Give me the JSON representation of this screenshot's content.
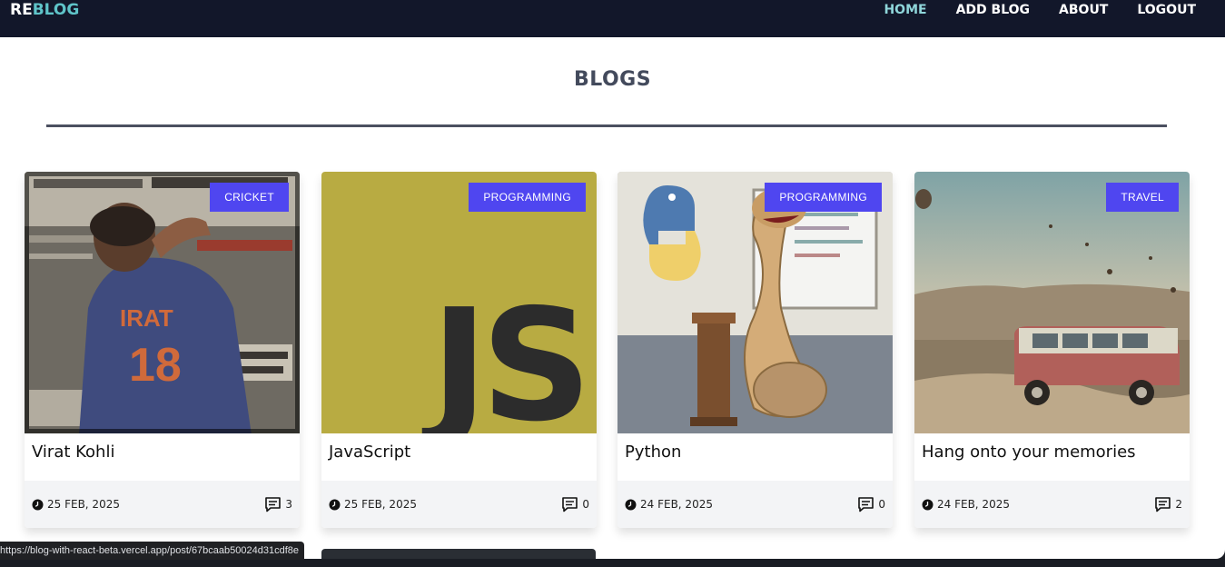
{
  "nav": {
    "logo_part1": "RE",
    "logo_part2": "BLOG",
    "links": [
      {
        "label": "HOME",
        "active": true
      },
      {
        "label": "ADD BLOG",
        "active": false
      },
      {
        "label": "ABOUT",
        "active": false
      },
      {
        "label": "LOGOUT",
        "active": false
      }
    ]
  },
  "page": {
    "title": "BLOGS"
  },
  "posts": [
    {
      "title": "Virat Kohli",
      "category": "CRICKET",
      "date": "25 FEB, 2025",
      "comments": "3"
    },
    {
      "title": "JavaScript",
      "category": "PROGRAMMING",
      "date": "25 FEB, 2025",
      "comments": "0"
    },
    {
      "title": "Python",
      "category": "PROGRAMMING",
      "date": "24 FEB, 2025",
      "comments": "0"
    },
    {
      "title": "Hang onto your memories",
      "category": "TRAVEL",
      "date": "24 FEB, 2025",
      "comments": "2"
    }
  ],
  "images": {
    "js_logo_text": "JS"
  },
  "status_bar": {
    "url": "https://blog-with-react-beta.vercel.app/post/67bcaab50024d31cdf8e"
  },
  "colors": {
    "navbar_bg": "#12172a",
    "accent_teal": "#5fc4c9",
    "badge": "#4f46f0",
    "heading": "#434a5c"
  }
}
